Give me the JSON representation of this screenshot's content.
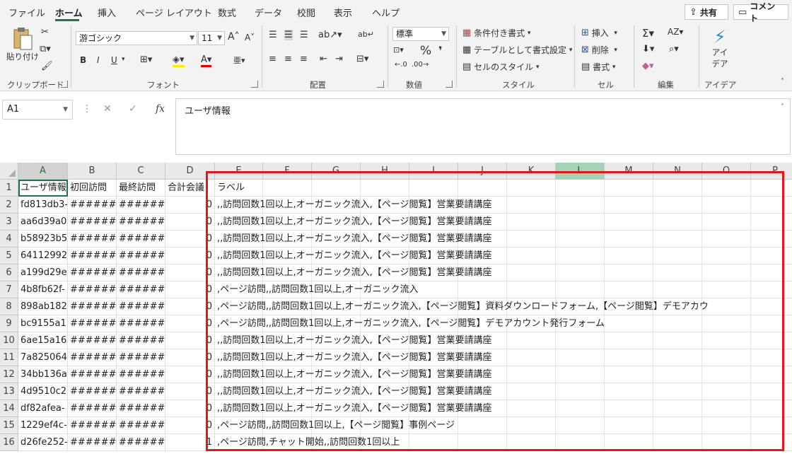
{
  "ribbon": {
    "tabs": [
      "ファイル",
      "ホーム",
      "挿入",
      "ページ レイアウト",
      "数式",
      "データ",
      "校閲",
      "表示",
      "ヘルプ"
    ],
    "share": "共有",
    "comment": "コメント",
    "clipboard": {
      "paste": "貼り付け",
      "label": "クリップボード"
    },
    "font": {
      "name": "游ゴシック",
      "size": "11",
      "label": "フォント",
      "bold": "B",
      "italic": "I",
      "underline": "U"
    },
    "alignment": {
      "label": "配置"
    },
    "number": {
      "format": "標準",
      "label": "数値",
      "percent": "%"
    },
    "styles": {
      "conditional": "条件付き書式",
      "table": "テーブルとして書式設定",
      "cell_styles": "セルのスタイル",
      "label": "スタイル"
    },
    "cells": {
      "insert": "挿入",
      "delete": "削除",
      "format": "書式",
      "label": "セル"
    },
    "editing": {
      "label": "編集"
    },
    "ideas": {
      "button_line1": "アイ",
      "button_line2": "デア",
      "label": "アイデア"
    }
  },
  "formula_bar": {
    "name_box": "A1",
    "fx": "fx",
    "content": "ユーザ情報"
  },
  "columns": [
    "A",
    "B",
    "C",
    "D",
    "E",
    "F",
    "G",
    "H",
    "I",
    "J",
    "K",
    "L",
    "M",
    "N",
    "O",
    "P"
  ],
  "rows": [
    {
      "num": "1",
      "a": "ユーザ情報",
      "b": "初回訪問",
      "c": "最終訪問",
      "d": "合計会議",
      "e": "ラベル"
    },
    {
      "num": "2",
      "a": "fd813db3-",
      "b": "#######",
      "c": "#######",
      "d": "0",
      "e": ",,訪問回数1回以上,オーガニック流入,【ページ閲覧】営業要請講座"
    },
    {
      "num": "3",
      "a": "aa6d39a0",
      "b": "#######",
      "c": "#######",
      "d": "0",
      "e": ",,訪問回数1回以上,オーガニック流入,【ページ閲覧】営業要請講座"
    },
    {
      "num": "4",
      "a": "b58923b5",
      "b": "#######",
      "c": "#######",
      "d": "0",
      "e": ",,訪問回数1回以上,オーガニック流入,【ページ閲覧】営業要請講座"
    },
    {
      "num": "5",
      "a": "64112992-",
      "b": "#######",
      "c": "#######",
      "d": "0",
      "e": ",,訪問回数1回以上,オーガニック流入,【ページ閲覧】営業要請講座"
    },
    {
      "num": "6",
      "a": "a199d29e",
      "b": "#######",
      "c": "#######",
      "d": "0",
      "e": ",,訪問回数1回以上,オーガニック流入,【ページ閲覧】営業要請講座"
    },
    {
      "num": "7",
      "a": "4b8fb62f-",
      "b": "#######",
      "c": "#######",
      "d": "0",
      "e": ",ページ訪問,,訪問回数1回以上,オーガニック流入"
    },
    {
      "num": "8",
      "a": "898ab182",
      "b": "#######",
      "c": "#######",
      "d": "0",
      "e": ",ページ訪問,,訪問回数1回以上,オーガニック流入,【ページ閲覧】資料ダウンロードフォーム,【ページ閲覧】デモアカウ"
    },
    {
      "num": "9",
      "a": "bc9155a1",
      "b": "#######",
      "c": "#######",
      "d": "0",
      "e": ",ページ訪問,,訪問回数1回以上,オーガニック流入,【ページ閲覧】デモアカウント発行フォーム"
    },
    {
      "num": "10",
      "a": "6ae15a16-",
      "b": "#######",
      "c": "#######",
      "d": "0",
      "e": ",,訪問回数1回以上,オーガニック流入,【ページ閲覧】営業要請講座"
    },
    {
      "num": "11",
      "a": "7a825064-",
      "b": "#######",
      "c": "#######",
      "d": "0",
      "e": ",,訪問回数1回以上,オーガニック流入,【ページ閲覧】営業要請講座"
    },
    {
      "num": "12",
      "a": "34bb136a",
      "b": "#######",
      "c": "#######",
      "d": "0",
      "e": ",,訪問回数1回以上,オーガニック流入,【ページ閲覧】営業要請講座"
    },
    {
      "num": "13",
      "a": "4d9510c2",
      "b": "#######",
      "c": "#######",
      "d": "0",
      "e": ",,訪問回数1回以上,オーガニック流入,【ページ閲覧】営業要請講座"
    },
    {
      "num": "14",
      "a": "df82afea-",
      "b": "#######",
      "c": "#######",
      "d": "0",
      "e": ",,訪問回数1回以上,オーガニック流入,【ページ閲覧】営業要請講座"
    },
    {
      "num": "15",
      "a": "1229ef4c-",
      "b": "#######",
      "c": "#######",
      "d": "0",
      "e": ",ページ訪問,,訪問回数1回以上,【ページ閲覧】事例ページ"
    },
    {
      "num": "16",
      "a": "d26fe252-",
      "b": "#######",
      "c": "#######",
      "d": "1",
      "e": ",ページ訪問,チャット開始,,訪問回数1回以上"
    }
  ]
}
